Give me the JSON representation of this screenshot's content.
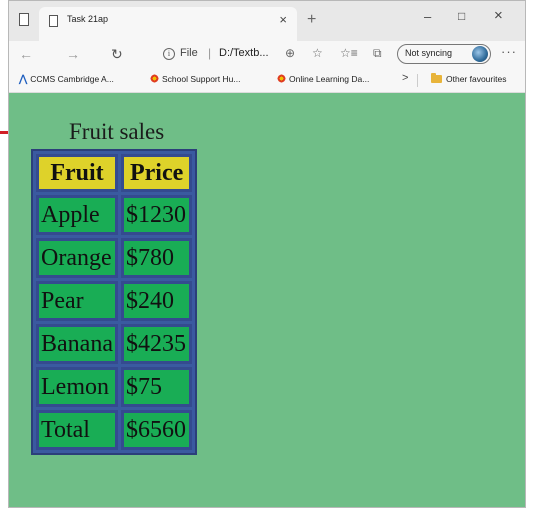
{
  "browser": {
    "tab_title": "Task 21ap",
    "tab_close": "×",
    "new_tab": "+",
    "window_controls": {
      "minimize": "–",
      "maximize": "□",
      "close": "×"
    },
    "nav": {
      "back": "←",
      "forward": "→",
      "refresh": "↻"
    },
    "address": {
      "info": "i",
      "scheme_label": "File",
      "separator": "|",
      "url": "D:/Textb..."
    },
    "toolbar_icons": {
      "zoom": "⊕",
      "favorite": "☆",
      "favorites_list": "☆≡",
      "collections": "⧉"
    },
    "sync_label": "Not syncing",
    "more": "···"
  },
  "favorites": [
    {
      "label": "CCMS Cambridge A...",
      "icon": "ccms-logo-icon"
    },
    {
      "label": "School Support Hu...",
      "icon": "flower-icon"
    },
    {
      "label": "Online Learning Da...",
      "icon": "flower-icon"
    }
  ],
  "favorites_more": ">",
  "other_favourites": "Other favourites",
  "page": {
    "caption": "Fruit sales",
    "headers": [
      "Fruit",
      "Price"
    ],
    "rows": [
      [
        "Apple",
        "$1230"
      ],
      [
        "Orange",
        "$780"
      ],
      [
        "Pear",
        "$240"
      ],
      [
        "Banana",
        "$4235"
      ],
      [
        "Lemon",
        "$75"
      ],
      [
        "Total",
        "$6560"
      ]
    ]
  },
  "colors": {
    "page_background": "#6fbe87",
    "header_cell": "#ded22a",
    "data_cell": "#19ad55",
    "table_border": "#344b8f",
    "arrow": "#d11f26"
  }
}
